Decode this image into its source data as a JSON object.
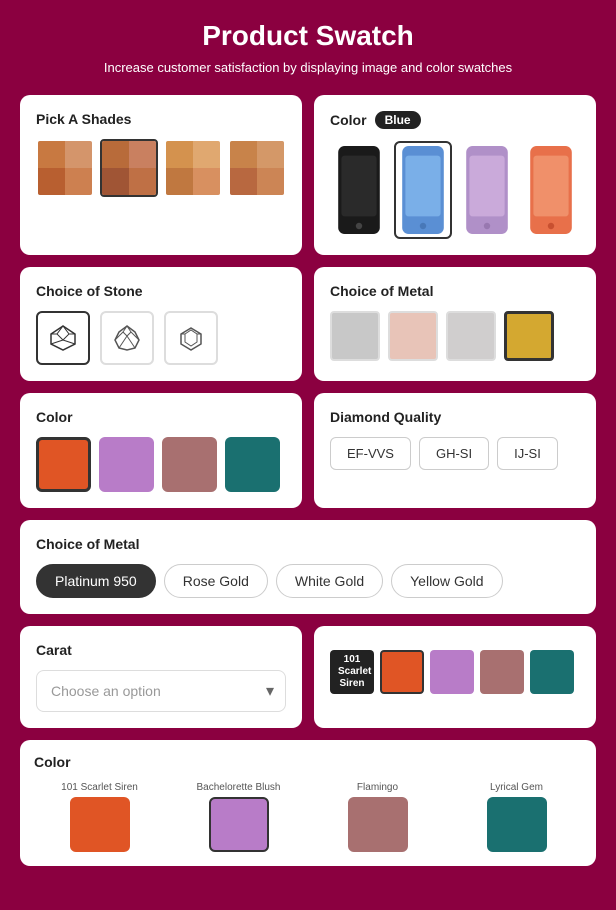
{
  "page": {
    "title": "Product Swatch",
    "subtitle": "Increase customer satisfaction by displaying image and color swatches"
  },
  "shades": {
    "title": "Pick A Shades",
    "options": [
      {
        "id": "shade1",
        "colors": [
          "#c87941",
          "#d4956b",
          "#b85f30",
          "#cd8050"
        ]
      },
      {
        "id": "shade2",
        "colors": [
          "#b86b3a",
          "#c98060",
          "#a05535",
          "#bf7045"
        ],
        "selected": true
      },
      {
        "id": "shade3",
        "colors": [
          "#d4924e",
          "#e0a870",
          "#c07840",
          "#d89060"
        ]
      },
      {
        "id": "shade4",
        "colors": [
          "#c8834a",
          "#d49868",
          "#b86840",
          "#cc8555"
        ]
      }
    ]
  },
  "colorImage": {
    "title": "Color",
    "badge": "Blue",
    "options": [
      {
        "id": "ci1",
        "bgColor": "#2a2a2a"
      },
      {
        "id": "ci2",
        "bgColor": "#4a90d9",
        "selected": true
      },
      {
        "id": "ci3",
        "bgColor": "#c5a8d4"
      },
      {
        "id": "ci4",
        "bgColor": "#e8704a"
      }
    ]
  },
  "choiceOfStone": {
    "title": "Choice of Stone",
    "options": [
      {
        "id": "s1",
        "selected": true
      },
      {
        "id": "s2"
      },
      {
        "id": "s3"
      }
    ]
  },
  "choiceOfMetalColor": {
    "title": "Choice of Metal",
    "options": [
      {
        "id": "m1",
        "color": "#c8c8c8"
      },
      {
        "id": "m2",
        "color": "#e8c4b8"
      },
      {
        "id": "m3",
        "color": "#d0cece"
      },
      {
        "id": "m4",
        "color": "#d4a830",
        "selected": true
      }
    ]
  },
  "colorSwatches": {
    "title": "Color",
    "options": [
      {
        "id": "col1",
        "color": "#e05525",
        "selected": true
      },
      {
        "id": "col2",
        "color": "#b87cc8"
      },
      {
        "id": "col3",
        "color": "#a87070"
      },
      {
        "id": "col4",
        "color": "#1a7070"
      }
    ]
  },
  "diamondQuality": {
    "title": "Diamond Quality",
    "options": [
      "EF-VVS",
      "GH-SI",
      "IJ-SI"
    ]
  },
  "choiceOfMetalText": {
    "title": "Choice of Metal",
    "options": [
      "Platinum 950",
      "Rose Gold",
      "White Gold",
      "Yellow Gold"
    ],
    "selected": "Platinum 950"
  },
  "carat": {
    "title": "Carat",
    "dropdown": {
      "placeholder": "Choose an option",
      "value": ""
    }
  },
  "caratColors": {
    "badge": {
      "line1": "101",
      "line2": "Scarlet",
      "line3": "Siren"
    },
    "options": [
      {
        "id": "cc1",
        "color": "#e05525",
        "selected": true
      },
      {
        "id": "cc2",
        "color": "#b87cc8"
      },
      {
        "id": "cc3",
        "color": "#a87070"
      },
      {
        "id": "cc4",
        "color": "#1a7070"
      }
    ]
  },
  "bottomColor": {
    "title": "Color",
    "options": [
      {
        "id": "bc1",
        "label": "101 Scarlet Siren",
        "color": "#e05525",
        "selected": false
      },
      {
        "id": "bc2",
        "label": "Bachelorette Blush",
        "color": "#b87cc8",
        "selected": true
      },
      {
        "id": "bc3",
        "label": "Flamingo",
        "color": "#a87070",
        "selected": false
      },
      {
        "id": "bc4",
        "label": "Lyrical Gem",
        "color": "#1a7070",
        "selected": false
      }
    ]
  }
}
